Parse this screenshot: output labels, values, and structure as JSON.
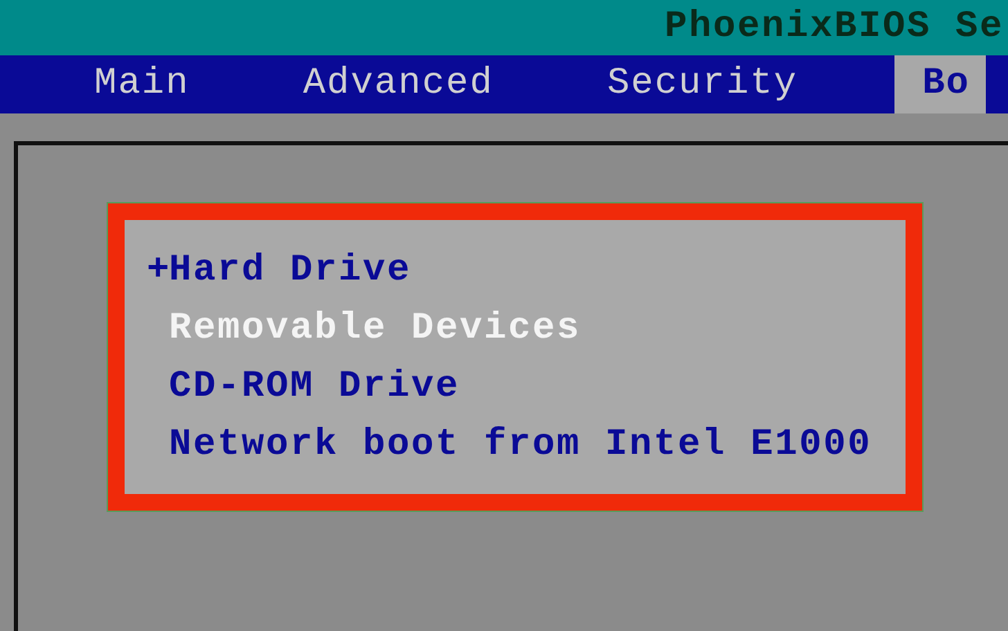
{
  "title": "PhoenixBIOS Se",
  "tabs": [
    {
      "label": "Main",
      "selected": false
    },
    {
      "label": "Advanced",
      "selected": false
    },
    {
      "label": "Security",
      "selected": false
    },
    {
      "label": "Bo",
      "selected": true
    }
  ],
  "boot_list": {
    "highlighted": true,
    "items": [
      {
        "marker": "+",
        "label": "Hard Drive",
        "selected": false
      },
      {
        "label": "Removable Devices",
        "selected": true
      },
      {
        "label": "CD-ROM Drive",
        "selected": false
      },
      {
        "label": "Network boot from Intel E1000",
        "selected": false
      }
    ]
  }
}
